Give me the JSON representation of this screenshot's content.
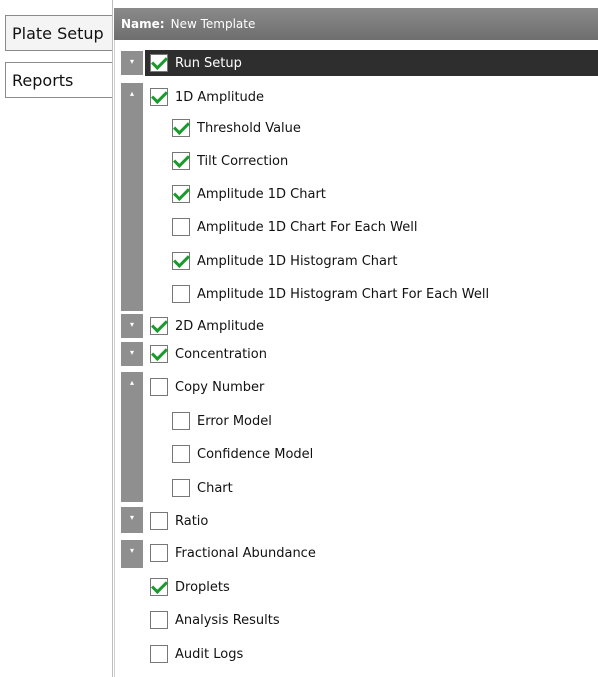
{
  "tabs": [
    {
      "label": "Plate Setup",
      "active": true
    },
    {
      "label": "Reports",
      "active": false
    }
  ],
  "header": {
    "name_label": "Name:",
    "name_value": "New Template"
  },
  "tree": {
    "run_setup": {
      "label": "Run Setup",
      "checked": true,
      "expander": "collapsed"
    },
    "amp1d": {
      "label": "1D Amplitude",
      "checked": true,
      "expander": "expanded"
    },
    "threshold": {
      "label": "Threshold Value",
      "checked": true
    },
    "tilt": {
      "label": "Tilt Correction",
      "checked": true
    },
    "amp1d_chart": {
      "label": "Amplitude 1D Chart",
      "checked": true
    },
    "amp1d_chart_each": {
      "label": "Amplitude 1D Chart For Each Well",
      "checked": false
    },
    "amp1d_hist": {
      "label": "Amplitude 1D Histogram Chart",
      "checked": true
    },
    "amp1d_hist_each": {
      "label": "Amplitude 1D Histogram Chart For Each Well",
      "checked": false
    },
    "amp2d": {
      "label": "2D Amplitude",
      "checked": true,
      "expander": "collapsed"
    },
    "concentration": {
      "label": "Concentration",
      "checked": true,
      "expander": "collapsed"
    },
    "copy_number": {
      "label": "Copy Number",
      "checked": false,
      "expander": "expanded"
    },
    "error_model": {
      "label": "Error Model",
      "checked": false
    },
    "confidence_model": {
      "label": "Confidence Model",
      "checked": false
    },
    "chart": {
      "label": "Chart",
      "checked": false
    },
    "ratio": {
      "label": "Ratio",
      "checked": false,
      "expander": "collapsed"
    },
    "fractional": {
      "label": "Fractional Abundance",
      "checked": false,
      "expander": "collapsed"
    },
    "droplets": {
      "label": "Droplets",
      "checked": true
    },
    "analysis": {
      "label": "Analysis Results",
      "checked": false
    },
    "audit": {
      "label": "Audit Logs",
      "checked": false
    }
  },
  "colors": {
    "check": "#1a9a2c",
    "header": "#7c7c7c",
    "selected_row": "#2e2e2e",
    "expander": "#8f8f8f"
  },
  "icons": {
    "collapsed": "chevron-down-icon",
    "expanded": "chevron-up-icon",
    "check": "checkmark-icon"
  }
}
